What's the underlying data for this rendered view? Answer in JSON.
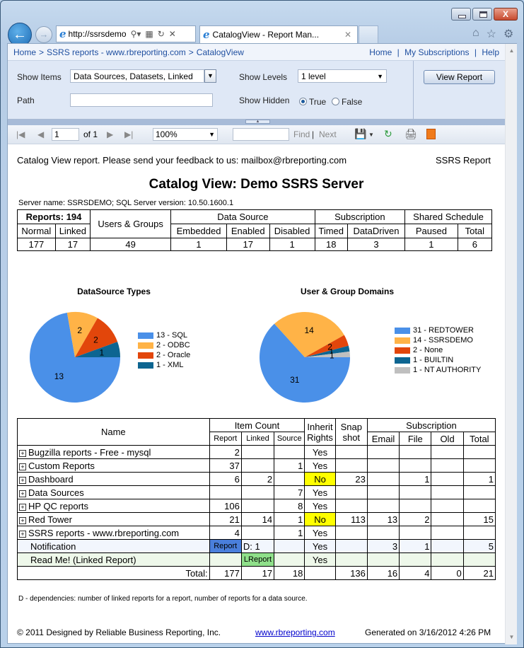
{
  "browser": {
    "address": "http://ssrsdemo",
    "tab_title": "CatalogView - Report Man...",
    "window_buttons": {
      "minimize": "minimize-icon",
      "maximize": "maximize-icon",
      "close": "X"
    },
    "command_icons": [
      "home-icon",
      "favorites-star-icon",
      "settings-gear-icon"
    ]
  },
  "breadcrumb": {
    "items": [
      "Home",
      "SSRS reports - www.rbreporting.com",
      "CatalogView"
    ],
    "separator": ">",
    "right_links": [
      "Home",
      "My Subscriptions",
      "Help"
    ]
  },
  "params": {
    "show_items_label": "Show Items",
    "show_items_value": "Data Sources, Datasets, Linked",
    "path_label": "Path",
    "path_value": "",
    "show_levels_label": "Show Levels",
    "show_levels_value": "1 level",
    "show_hidden_label": "Show Hidden",
    "show_hidden_options": [
      "True",
      "False"
    ],
    "show_hidden_selected": "True",
    "view_report_button": "View Report"
  },
  "toolbar": {
    "page": "1",
    "of_label": "of 1",
    "zoom": "100%",
    "find_value": "",
    "find_label": "Find",
    "next_label": "Next",
    "divider": "|"
  },
  "report": {
    "feedback": "Catalog View report. Please send your feedback to us: mailbox@rbreporting.com",
    "tag": "SSRS Report",
    "title": "Catalog View: Demo SSRS Server",
    "server_info": "Server name: SSRSDEMO; SQL Server version: 10.50.1600.1",
    "summary": {
      "groups": [
        "Reports: 194",
        "Users & Groups",
        "Data Source",
        "Subscription",
        "Shared Schedule"
      ],
      "columns": [
        "Normal",
        "Linked",
        "Embedded",
        "Enabled",
        "Disabled",
        "Timed",
        "DataDriven",
        "Paused",
        "Total"
      ],
      "values": [
        "177",
        "17",
        "49",
        "1",
        "17",
        "1",
        "18",
        "3",
        "1",
        "6"
      ]
    },
    "items_table": {
      "headers": {
        "name": "Name",
        "item_count": "Item Count",
        "report": "Report",
        "linked": "Linked",
        "source": "Source",
        "inherit_rights": "Inherit Rights",
        "snapshot": "Snap shot",
        "subscription": "Subscription",
        "email": "Email",
        "file": "File",
        "old": "Old",
        "total": "Total"
      },
      "rows": [
        {
          "name": "Bugzilla reports - Free - mysql",
          "expand": true,
          "report": "2",
          "linked": "",
          "source": "",
          "inherit": "Yes",
          "snapshot": "",
          "email": "",
          "file": "",
          "old": "",
          "total": ""
        },
        {
          "name": "Custom Reports",
          "expand": true,
          "report": "37",
          "linked": "",
          "source": "1",
          "inherit": "Yes",
          "snapshot": "",
          "email": "",
          "file": "",
          "old": "",
          "total": ""
        },
        {
          "name": "Dashboard",
          "expand": true,
          "report": "6",
          "linked": "2",
          "source": "",
          "inherit": "No",
          "snapshot": "23",
          "email": "",
          "file": "1",
          "old": "",
          "total": "1"
        },
        {
          "name": "Data Sources",
          "expand": true,
          "report": "",
          "linked": "",
          "source": "7",
          "inherit": "Yes",
          "snapshot": "",
          "email": "",
          "file": "",
          "old": "",
          "total": ""
        },
        {
          "name": "HP QC reports",
          "expand": true,
          "report": "106",
          "linked": "",
          "source": "8",
          "inherit": "Yes",
          "snapshot": "",
          "email": "",
          "file": "",
          "old": "",
          "total": ""
        },
        {
          "name": "Red Tower",
          "expand": true,
          "report": "21",
          "linked": "14",
          "source": "1",
          "inherit": "No",
          "snapshot": "113",
          "email": "13",
          "file": "2",
          "old": "",
          "total": "15"
        },
        {
          "name": "SSRS reports - www.rbreporting.com",
          "expand": true,
          "report": "4",
          "linked": "",
          "source": "1",
          "inherit": "Yes",
          "snapshot": "",
          "email": "",
          "file": "",
          "old": "",
          "total": ""
        },
        {
          "name": "Notification",
          "expand": false,
          "report": "Report",
          "linked": "D: 1",
          "source": "",
          "inherit": "Yes",
          "snapshot": "",
          "email": "3",
          "file": "1",
          "old": "",
          "total": "5"
        },
        {
          "name": "Read Me! (Linked Report)",
          "expand": false,
          "report": "",
          "linked": "LReport",
          "source": "",
          "inherit": "Yes",
          "snapshot": "",
          "email": "",
          "file": "",
          "old": "",
          "total": ""
        }
      ],
      "totals": {
        "label": "Total:",
        "report": "177",
        "linked": "17",
        "source": "18",
        "inherit": "",
        "snapshot": "136",
        "email": "16",
        "file": "4",
        "old": "0",
        "total": "21"
      }
    },
    "footnote": "D - dependencies: number of linked reports for a report, number of reports for a data source.",
    "footer": {
      "copyright": "© 2011 Designed by Reliable Business Reporting, Inc.",
      "link": "www.rbreporting.com",
      "generated": "Generated on 3/16/2012 4:26 PM"
    },
    "colors": {
      "highlight_no": "#ffff00",
      "report_badge": "#4a7fdc",
      "lreport_badge": "#8fe08a"
    }
  },
  "chart_data": [
    {
      "type": "pie",
      "title": "DataSource Types",
      "categories": [
        "SQL",
        "ODBC",
        "Oracle",
        "XML"
      ],
      "values": [
        13,
        2,
        2,
        1
      ],
      "legend": [
        "13 - SQL",
        "2 - ODBC",
        "2 - Oracle",
        "1 - XML"
      ],
      "colors": [
        "#4a90e8",
        "#ffb347",
        "#e2460b",
        "#0d6591"
      ],
      "legend_position": "right",
      "data_labels": [
        "13",
        "2",
        "2",
        "1"
      ]
    },
    {
      "type": "pie",
      "title": "User & Group Domains",
      "categories": [
        "REDTOWER",
        "SSRSDEMO",
        "None",
        "BUILTIN",
        "NT AUTHORITY"
      ],
      "values": [
        31,
        14,
        2,
        1,
        1
      ],
      "legend": [
        "31 - REDTOWER",
        "14 - SSRSDEMO",
        "2 - None",
        "1 - BUILTIN",
        "1 - NT AUTHORITY"
      ],
      "colors": [
        "#4a90e8",
        "#ffb347",
        "#e2460b",
        "#0d6591",
        "#bfbfbf"
      ],
      "legend_position": "right",
      "data_labels": [
        "31",
        "14",
        "2",
        "1",
        "1"
      ]
    }
  ]
}
